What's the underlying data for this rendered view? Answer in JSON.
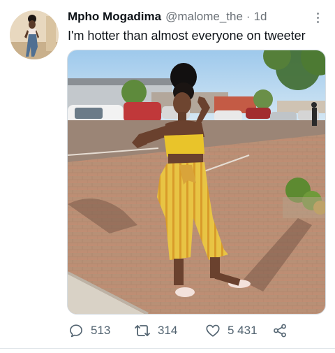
{
  "tweet": {
    "display_name": "Mpho Mogadima",
    "handle": "@malome_the",
    "separator": "·",
    "time": "1d",
    "text": "I'm hotter than almost everyone on tweeter"
  },
  "actions": {
    "reply_count": "513",
    "retweet_count": "314",
    "like_count": "5 431"
  },
  "icons": {
    "reply": "reply-icon",
    "retweet": "retweet-icon",
    "like": "heart-icon",
    "share": "share-icon",
    "more": "more-icon"
  },
  "colors": {
    "text_primary": "#0f1419",
    "text_secondary": "#536471",
    "outfit_yellow": "#e7c33a"
  }
}
